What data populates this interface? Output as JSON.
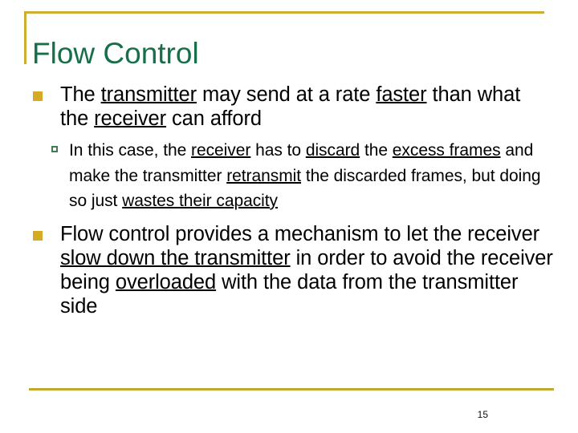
{
  "slide": {
    "title": "Flow Control",
    "page_number": "15",
    "colors": {
      "title_green": "#15704a",
      "rule_gold": "#cdae33",
      "bullet_level1_gold": "#d4ab24",
      "bullet_level2_green": "#3f7a52",
      "body_text": "#000000",
      "background": "#ffffff"
    },
    "bullets": [
      {
        "level": 1,
        "marker": "filled-square",
        "runs": [
          {
            "text": "The ",
            "underline": false
          },
          {
            "text": "transmitter",
            "underline": true
          },
          {
            "text": " may send at a rate ",
            "underline": false
          },
          {
            "text": "faster",
            "underline": true
          },
          {
            "text": " than what the ",
            "underline": false
          },
          {
            "text": "receiver",
            "underline": true
          },
          {
            "text": " can afford",
            "underline": false
          }
        ],
        "plain_text": "The transmitter may send at a rate faster than what the receiver can afford"
      },
      {
        "level": 2,
        "marker": "hollow-square",
        "runs": [
          {
            "text": "In this case, the ",
            "underline": false
          },
          {
            "text": "receiver",
            "underline": true
          },
          {
            "text": " has to ",
            "underline": false
          },
          {
            "text": "discard",
            "underline": true
          },
          {
            "text": " the ",
            "underline": false
          },
          {
            "text": "excess frames",
            "underline": true
          },
          {
            "text": " and make the transmitter ",
            "underline": false
          },
          {
            "text": "retransmit",
            "underline": true
          },
          {
            "text": " the discarded frames, but doing so just ",
            "underline": false
          },
          {
            "text": "wastes their capacity",
            "underline": true
          }
        ],
        "plain_text": "In this case, the receiver has to discard the excess frames and make the transmitter retransmit the discarded frames, but doing so just wastes their capacity"
      },
      {
        "level": 1,
        "marker": "filled-square",
        "runs": [
          {
            "text": "Flow control provides a mechanism to let the receiver ",
            "underline": false
          },
          {
            "text": "slow down the transmitter",
            "underline": true
          },
          {
            "text": " in order to avoid the receiver being ",
            "underline": false
          },
          {
            "text": "overloaded",
            "underline": true
          },
          {
            "text": " with the data from the transmitter side",
            "underline": false
          }
        ],
        "plain_text": "Flow control provides a mechanism to let the receiver slow down the transmitter in order to avoid the receiver being overloaded with the data from the transmitter side"
      }
    ]
  }
}
